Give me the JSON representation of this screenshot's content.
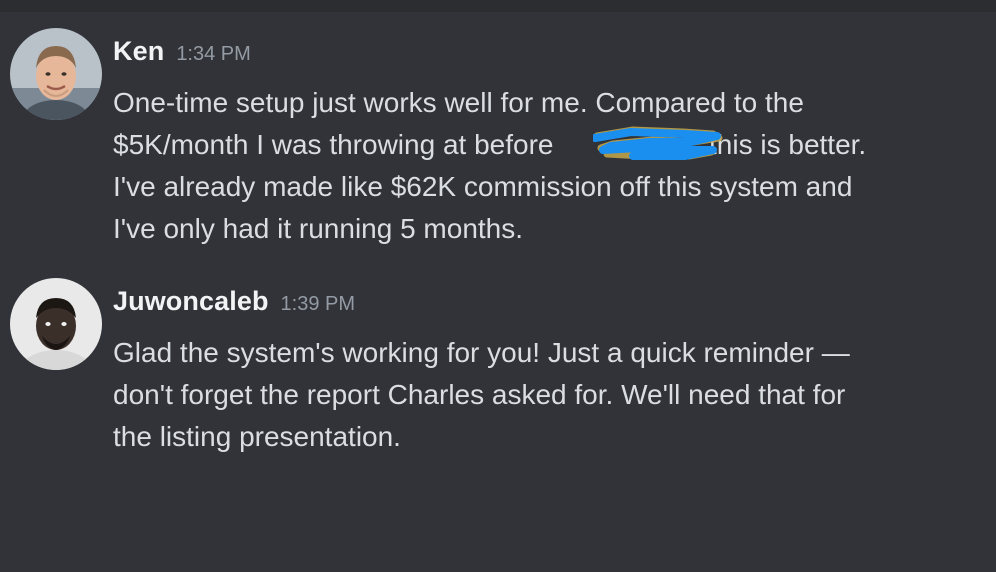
{
  "theme": {
    "background": "#313338",
    "username_color": "#f2f3f5",
    "timestamp_color": "#949ba4",
    "text_color": "#dbdee1",
    "redaction_color": "#1b8ff0"
  },
  "messages": [
    {
      "avatar_icon": "user-avatar-ken",
      "username": "Ken",
      "timestamp": "1:34 PM",
      "lines": [
        "One-time setup just works well for me. Compared to the",
        "$5K/month I was throwing at before ",
        "vc this is better.",
        "I've already made like $62K commission off this system and",
        "I've only had it running 5 months."
      ]
    },
    {
      "avatar_icon": "user-avatar-juwoncaleb",
      "username": "Juwoncaleb",
      "timestamp": "1:39 PM",
      "lines": [
        "Glad the system's working for you! Just a quick reminder —",
        "don't forget the report Charles asked for. We'll need that for",
        "the listing presentation."
      ]
    }
  ]
}
